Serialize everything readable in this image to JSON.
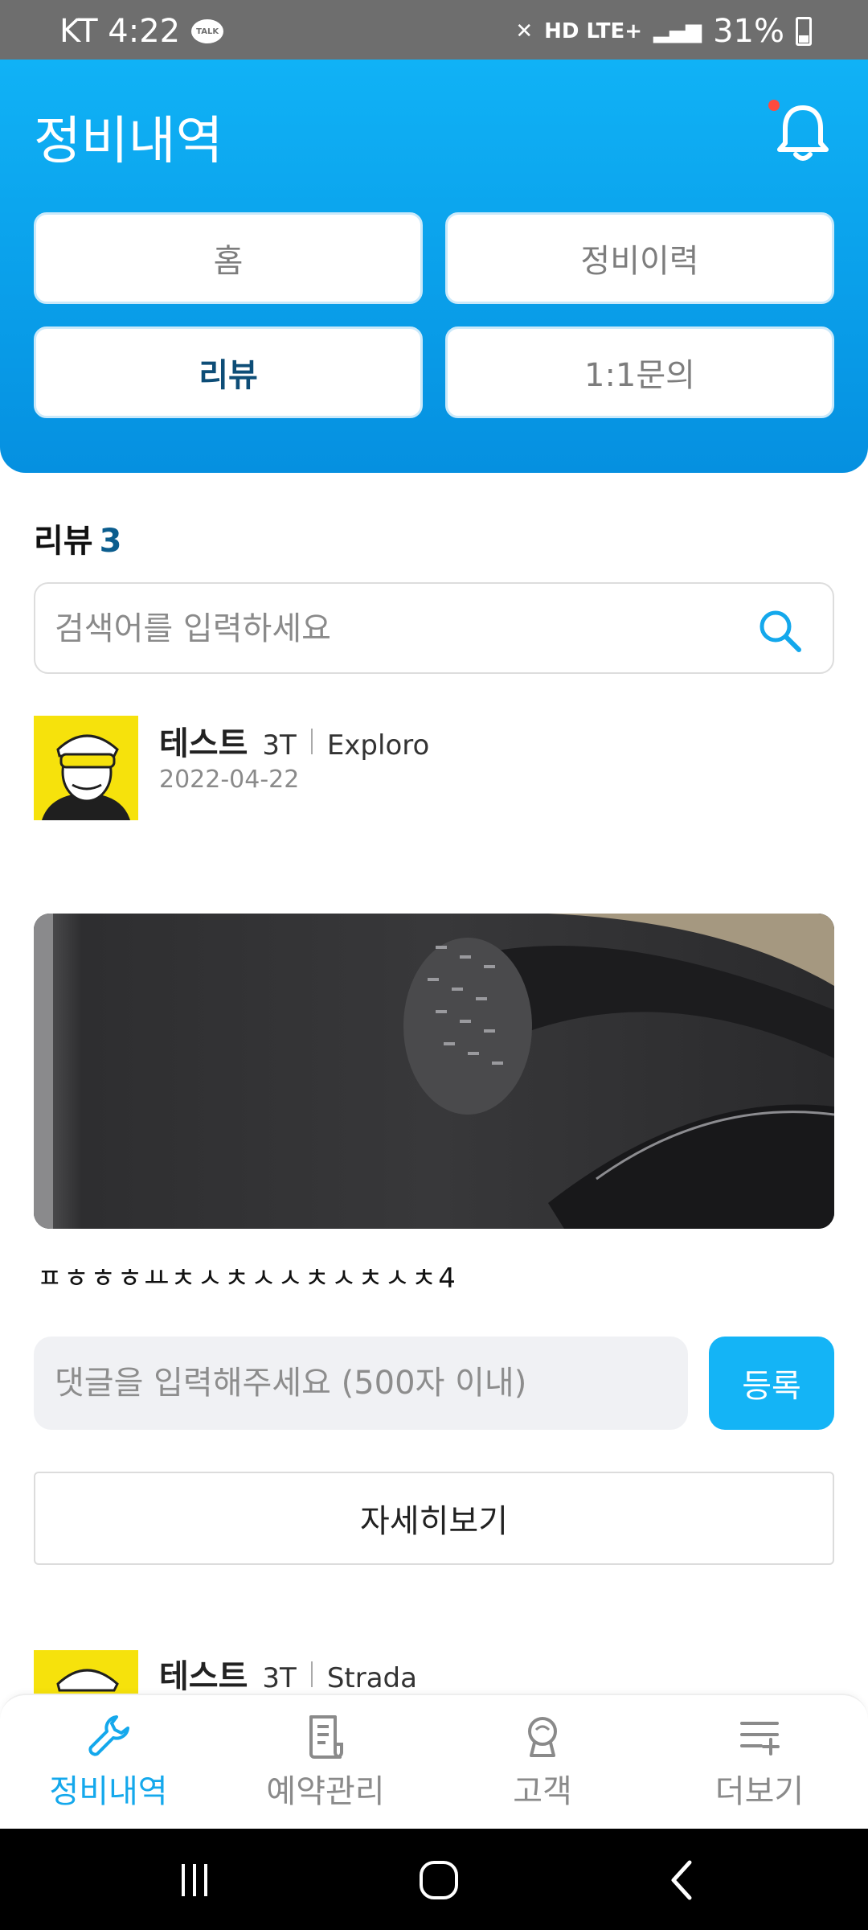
{
  "status_bar": {
    "carrier_time": "KT 4:22",
    "talk_badge": "TALK",
    "network": "HD LTE+",
    "battery": "31%"
  },
  "header": {
    "title": "정비내역",
    "nav": [
      "홈",
      "정비이력",
      "리뷰",
      "1:1문의"
    ],
    "active_nav": "리뷰"
  },
  "reviews": {
    "label": "리뷰",
    "count": "3",
    "search_placeholder": "검색어를 입력하세요",
    "items": [
      {
        "name": "테스트",
        "brand": "3T",
        "model": "Exploro",
        "date": "2022-04-22",
        "text": "ㅍㅎㅎㅎㅛㅊㅅㅊㅅㅅㅊㅅㅊㅅㅊ4",
        "comment_placeholder": "댓글을 입력해주세요 (500자 이내)",
        "submit_label": "등록",
        "detail_label": "자세히보기"
      },
      {
        "name": "테스트",
        "brand": "3T",
        "model": "Strada"
      }
    ]
  },
  "bottom_nav": [
    {
      "label": "정비내역",
      "icon": "wrench-icon",
      "active": true
    },
    {
      "label": "예약관리",
      "icon": "document-icon",
      "active": false
    },
    {
      "label": "고객",
      "icon": "customer-badge-icon",
      "active": false
    },
    {
      "label": "더보기",
      "icon": "list-add-icon",
      "active": false
    }
  ],
  "colors": {
    "primary": "#14b4f6",
    "header_gradient_top": "#10b2f6",
    "header_gradient_bottom": "#0590e0",
    "active_nav_text": "#0d4d77",
    "notification_dot": "#ff4b3e"
  }
}
